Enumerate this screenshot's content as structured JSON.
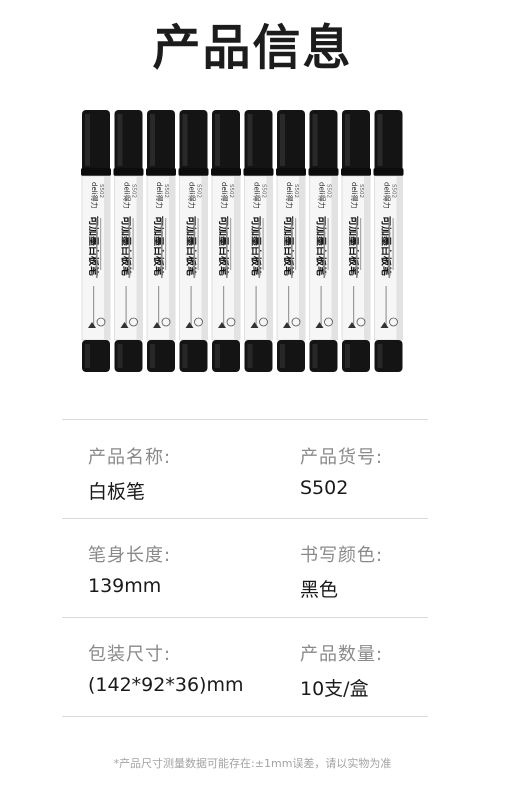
{
  "header": {
    "title": "产品信息"
  },
  "product_image": {
    "brand_text": "deli得力",
    "model_text": "S502",
    "body_text": "可加墨白板笔",
    "count": 10
  },
  "specs": [
    {
      "label": "产品名称:",
      "value": "白板笔"
    },
    {
      "label": "产品货号:",
      "value": "S502"
    },
    {
      "label": "笔身长度:",
      "value": "139mm"
    },
    {
      "label": "书写颜色:",
      "value": "黑色"
    },
    {
      "label": "包装尺寸:",
      "value": "(142*92*36)mm"
    },
    {
      "label": "产品数量:",
      "value": "10支/盒"
    }
  ],
  "footnote": "*产品尺寸测量数据可能存在:±1mm误差，请以实物为准"
}
